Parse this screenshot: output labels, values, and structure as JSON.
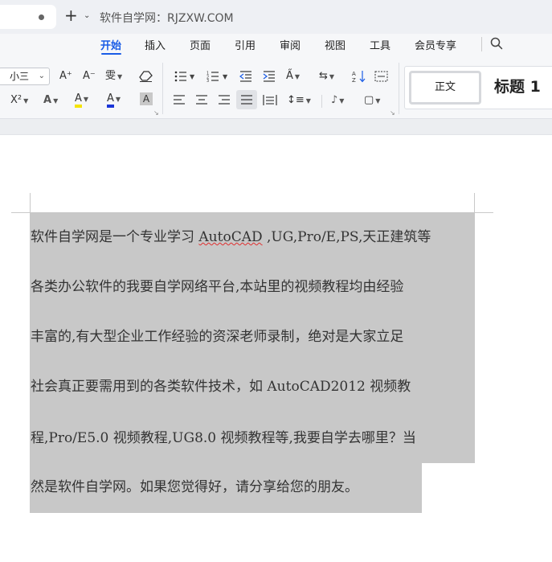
{
  "titlebar": {
    "site_title": "软件自学网：RJZXW.COM"
  },
  "menu": {
    "items": [
      "开始",
      "插入",
      "页面",
      "引用",
      "审阅",
      "视图",
      "工具",
      "会员专享"
    ],
    "active_index": 0
  },
  "toolbar": {
    "font_size": "小三",
    "grow_font": "A⁺",
    "shrink_font": "A⁻",
    "phonetic": "雯",
    "superscript": "X²",
    "text_effect": "A",
    "highlight": "A",
    "font_color": "A",
    "char_shading": "A",
    "highlight_color": "#f5e400",
    "font_color_bar": "#1a35d8"
  },
  "styles": {
    "normal": "正文",
    "heading1": "标题 1"
  },
  "document": {
    "lines": [
      [
        "软件自学网是一个专业学习 ",
        "AutoCAD",
        " ,UG,Pro/E,PS,天正建筑等"
      ],
      [
        "各类办公软件的我要自学网络平台,本站里的视频教程均由经验"
      ],
      [
        "丰富的,有大型企业工作经验的资深老师录制，绝对是大家立足"
      ],
      [
        "社会真正要需用到的各类软件技术，如 AutoCAD2012 视频教"
      ],
      [
        "程,Pro/E5.0 视频教程,UG8.0 视频教程等,我要自学去哪里？当"
      ],
      [
        "然是软件自学网。如果您觉得好，请分享给您的朋友。"
      ]
    ]
  }
}
